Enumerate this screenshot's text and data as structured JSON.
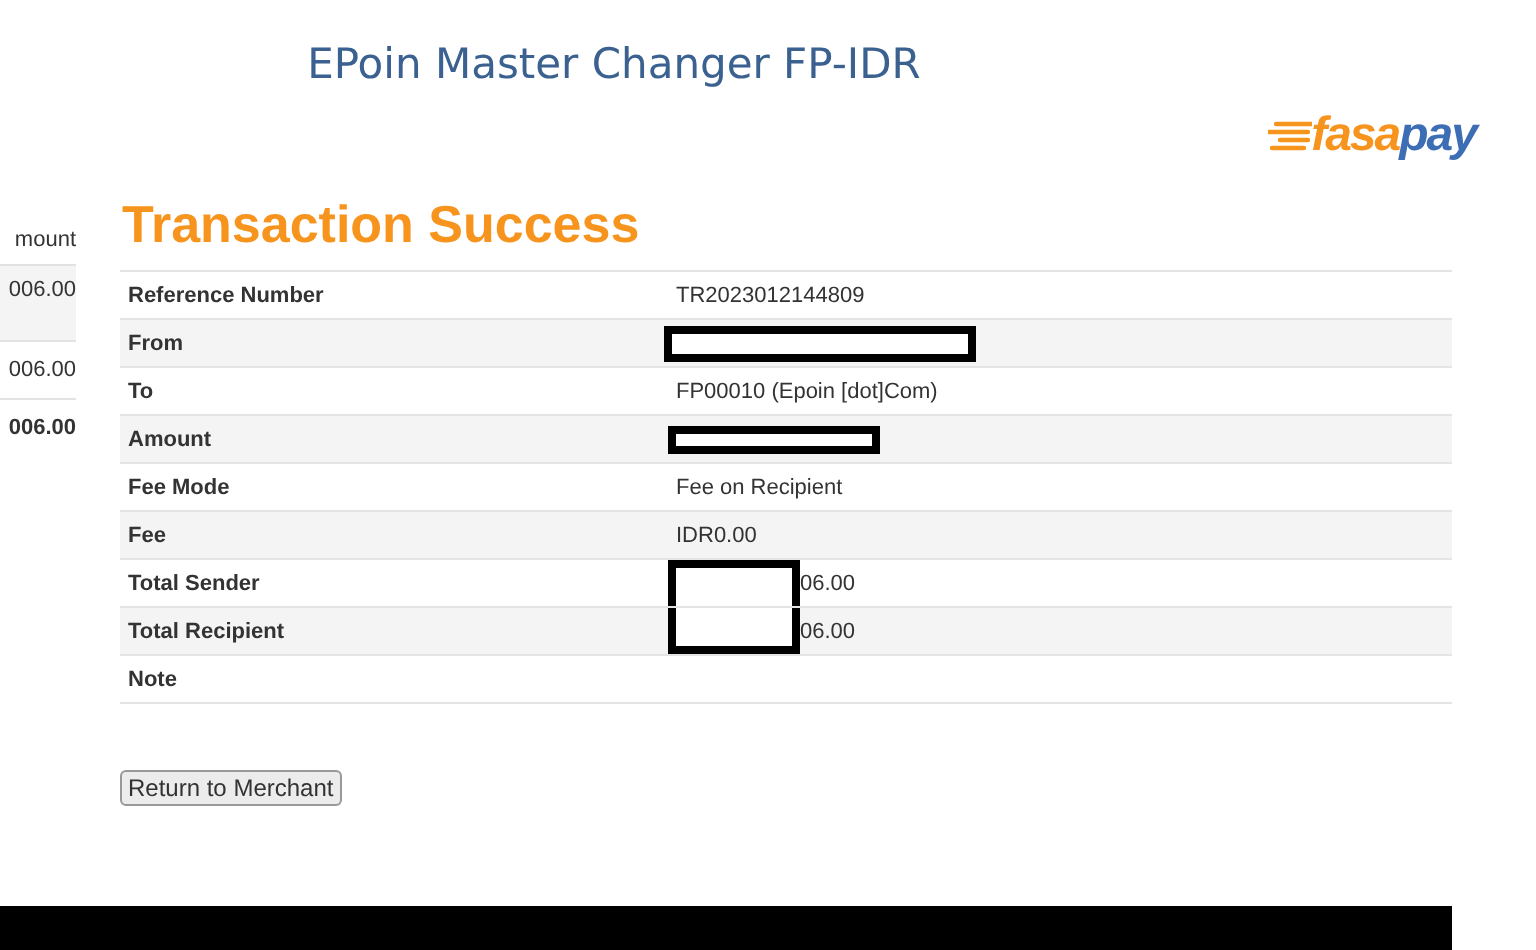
{
  "title": "EPoin Master Changer FP-IDR",
  "logo": {
    "part_1": "fasa",
    "part_2": "pay"
  },
  "side_table": {
    "header": "mount",
    "rows": [
      {
        "value": "006.00",
        "bold": false
      },
      {
        "value": "006.00",
        "bold": false
      },
      {
        "value": "006.00",
        "bold": true
      }
    ]
  },
  "heading": "Transaction Success",
  "details": [
    {
      "label": "Reference Number",
      "value": "TR2023012144809",
      "redacted": false
    },
    {
      "label": "From",
      "redacted": true
    },
    {
      "label": "To",
      "value": "FP00010 (Epoin [dot]Com)",
      "redacted": false
    },
    {
      "label": "Amount",
      "redacted": true
    },
    {
      "label": "Fee Mode",
      "value": "Fee on Recipient",
      "redacted": false
    },
    {
      "label": "Fee",
      "value": "IDR0.00",
      "redacted": false
    },
    {
      "label": "Total Sender",
      "value": "06.00",
      "redacted": true
    },
    {
      "label": "Total Recipient",
      "value": "06.00",
      "redacted": true
    },
    {
      "label": "Note",
      "redacted": false
    }
  ],
  "button": "Return to Merchant"
}
